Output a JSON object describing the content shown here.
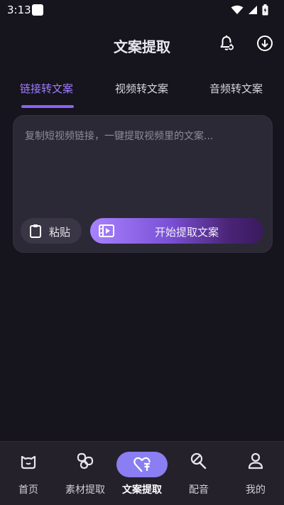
{
  "status_bar": {
    "time": "3:13"
  },
  "header": {
    "title": "文案提取",
    "icons": [
      "bell-icon",
      "download-icon"
    ]
  },
  "tabs": [
    {
      "label": "链接转文案",
      "active": true
    },
    {
      "label": "视频转文案",
      "active": false
    },
    {
      "label": "音频转文案",
      "active": false
    }
  ],
  "card": {
    "placeholder": "复制短视频链接，一键提取视频里的文案...",
    "paste_label": "粘贴",
    "start_label": "开始提取文案"
  },
  "bottom_nav": [
    {
      "label": "首页",
      "icon": "home-icon",
      "active": false
    },
    {
      "label": "素材提取",
      "icon": "material-icon",
      "active": false
    },
    {
      "label": "文案提取",
      "icon": "text-extract-icon",
      "active": true
    },
    {
      "label": "配音",
      "icon": "dubbing-icon",
      "active": false
    },
    {
      "label": "我的",
      "icon": "profile-icon",
      "active": false
    }
  ],
  "colors": {
    "accent": "#8b63f6",
    "background": "#16141c",
    "card": "#2c2936",
    "nav_active": "#8a7ef2"
  }
}
